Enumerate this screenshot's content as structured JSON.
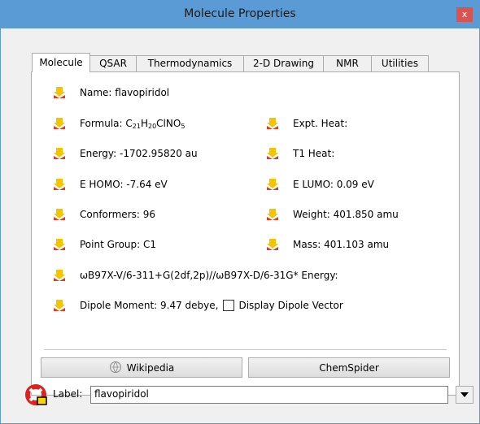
{
  "window": {
    "title": "Molecule Properties",
    "close_glyph": "x"
  },
  "tabs": [
    "Molecule",
    "QSAR",
    "Thermodynamics",
    "2-D Drawing",
    "NMR",
    "Utilities"
  ],
  "properties": {
    "name": "Name: flavopiridol",
    "formula_prefix": "Formula: C",
    "formula_c": "21",
    "formula_h_prefix": "H",
    "formula_h": "20",
    "formula_rest": "ClNO",
    "formula_o": "5",
    "energy": "Energy: -1702.95820 au",
    "e_homo": "E HOMO: -7.64 eV",
    "conformers": "Conformers: 96",
    "point_group": "Point Group: C1",
    "expt_heat": "Expt. Heat:",
    "t1_heat": "T1 Heat:",
    "e_lumo": "E LUMO: 0.09 eV",
    "weight": "Weight: 401.850 amu",
    "mass": "Mass: 401.103 amu",
    "method_energy": "ωB97X-V/6-311+G(2df,2p)//ωB97X-D/6-31G* Energy:",
    "dipole": "Dipole Moment: 9.47 debye,",
    "display_dipole_label": "Display Dipole Vector"
  },
  "buttons": {
    "wikipedia": "Wikipedia",
    "chemspider": "ChemSpider"
  },
  "label_field": {
    "label": "Label:",
    "value": "flavopiridol"
  },
  "colors": {
    "titlebar": "#5b9bd5",
    "close": "#d9534f",
    "icon_yellow": "#f5c400",
    "icon_red": "#e03a1e"
  },
  "icons": {
    "property": "property-arrow-icon",
    "wikipedia": "wikipedia-globe-icon",
    "label": "lifebuoy-label-icon",
    "dropdown": "chevron-down-icon"
  }
}
